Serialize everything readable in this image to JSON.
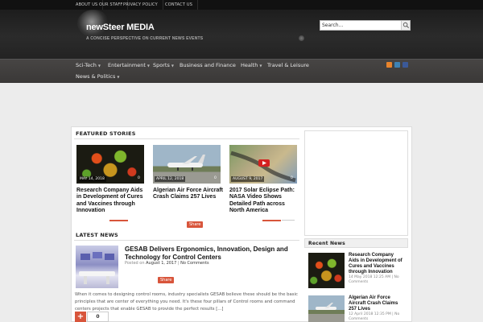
{
  "topbar": {
    "links": [
      "ABOUT US",
      "OUR STAFF",
      "PRIVACY POLICY",
      "CONTACT US"
    ]
  },
  "header": {
    "logo": "newSteer MEDIA",
    "tagline": "A CONCISE PERSPECTIVE ON CURRENT NEWS EVENTS",
    "search_value": "Search..."
  },
  "nav": {
    "items": [
      "Sci-Tech",
      "Entertainment",
      "Sports",
      "Business and Finance",
      "Health",
      "Travel & Leisure",
      "News & Politics"
    ]
  },
  "featured": {
    "heading": "FEATURED STORIES",
    "stories": [
      {
        "date": "MAY 14, 2018",
        "count": "0",
        "title": "Research Company Aids in Development of Cures and Vaccines through Innovation"
      },
      {
        "date": "APRIL 12, 2018",
        "count": "0",
        "title": "Algerian Air Force Aircraft Crash Claims 257 Lives"
      },
      {
        "date": "AUGUST 9, 2017",
        "count": "0",
        "title": "2017 Solar Eclipse Path: NASA Video Shows Detailed Path across North America"
      }
    ],
    "share_label": "Share"
  },
  "latest": {
    "heading": "LATEST NEWS",
    "article": {
      "title": "GESAB Delivers Ergonomics, Innovation, Design and Technology for Control Centers",
      "posted": "Posted on",
      "date": "August 1, 2017",
      "sep": "|",
      "comments": "No Comments",
      "share_label": "Share",
      "excerpt": "When it comes to designing control rooms, industry specialists GESAB believe these should be the basic principles that are center of everything you need. It's these four pillars of Control rooms and command centers projects that enable GESAB to provide the perfect results [...]",
      "plus": "+",
      "count": "0"
    }
  },
  "sidebar": {
    "recent_heading": "Recent News",
    "items": [
      {
        "title": "Research Company Aids in Development of Cures and Vaccines through Innovation",
        "meta": "14 May 2018 12:25 AM | No Comments"
      },
      {
        "title": "Algerian Air Force Aircraft Crash Claims 257 Lives",
        "meta": "12 April 2018 12:35 PM | No Comments"
      }
    ]
  },
  "colors": {
    "accent": "#d8553b",
    "nav_bg": "#413f3e",
    "header_bg": "#232323"
  }
}
